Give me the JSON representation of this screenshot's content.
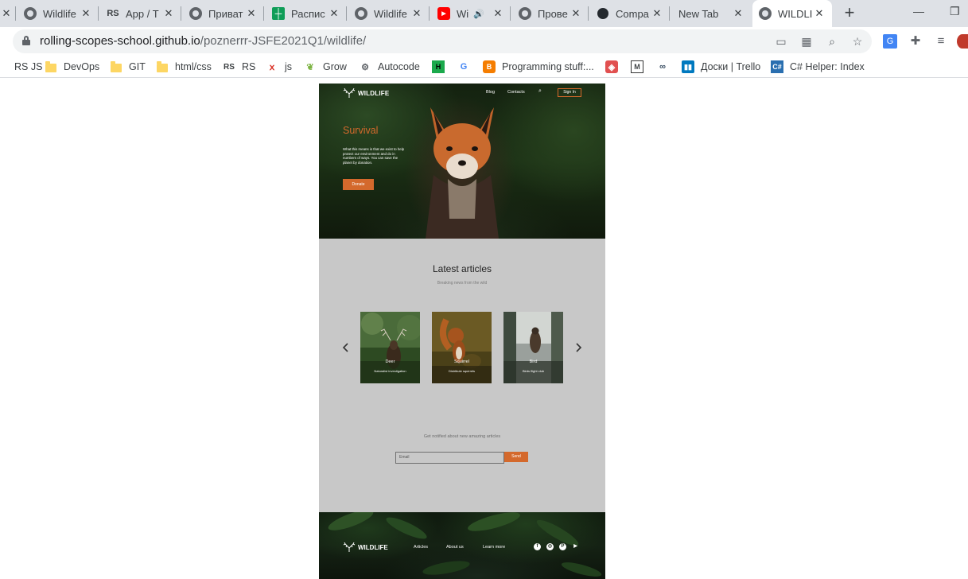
{
  "browser": {
    "tabs": [
      {
        "title": "",
        "icon": "x-close-icon"
      },
      {
        "title": "Wildlife",
        "icon": "globe-icon"
      },
      {
        "title": "App / T",
        "icon": "rs-logo-icon"
      },
      {
        "title": "Приват",
        "icon": "globe-icon"
      },
      {
        "title": "Распис",
        "icon": "sheets-icon"
      },
      {
        "title": "Wildlife",
        "icon": "globe-icon"
      },
      {
        "title": "Wi",
        "icon": "youtube-icon"
      },
      {
        "title": "Прове",
        "icon": "globe-icon"
      },
      {
        "title": "Compa",
        "icon": "github-icon"
      },
      {
        "title": "New Tab",
        "icon": ""
      },
      {
        "title": "WILDLI",
        "icon": "globe-icon"
      }
    ],
    "new_tab_label": "+",
    "url_host": "rolling-scopes-school.github.io",
    "url_path": "/poznerrr-JSFE2021Q1/wildlife/",
    "bookmarks": [
      {
        "label": "RS JS",
        "icon": "page-icon"
      },
      {
        "label": "DevOps",
        "icon": "folder-icon"
      },
      {
        "label": "GIT",
        "icon": "folder-icon"
      },
      {
        "label": "html/css",
        "icon": "folder-icon"
      },
      {
        "label": "RS",
        "icon": "rs-logo-icon"
      },
      {
        "label": "js",
        "icon": "js-icon"
      },
      {
        "label": "Grow",
        "icon": "leaf-icon"
      },
      {
        "label": "Autocode",
        "icon": "autocode-icon"
      },
      {
        "label": "",
        "icon": "hackerrank-icon"
      },
      {
        "label": "",
        "icon": "google-icon"
      },
      {
        "label": "Programming stuff:...",
        "icon": "blogger-icon"
      },
      {
        "label": "",
        "icon": "codepen-icon"
      },
      {
        "label": "",
        "icon": "gmail-icon"
      },
      {
        "label": "",
        "icon": "binoculars-icon"
      },
      {
        "label": "Доски | Trello",
        "icon": "trello-icon"
      },
      {
        "label": "C# Helper: Index",
        "icon": "csharp-icon"
      }
    ]
  },
  "site": {
    "logo": "WILDLIFE",
    "nav": {
      "blog": "Blog",
      "contacts": "Contacts",
      "signin": "Sign In"
    },
    "hero": {
      "title": "Survival",
      "text": "What this means is that we exist to help protect our environment and do in numbers of ways. You can save the planet by donation.",
      "donate": "Donate"
    },
    "articles": {
      "title": "Latest articles",
      "subtitle": "Breaking news from the wild",
      "cards": [
        {
          "name": "Deer",
          "desc": "Naturalist investigation"
        },
        {
          "name": "Squirrel",
          "desc": "Distribute squirrels"
        },
        {
          "name": "Bird",
          "desc": "Birds flight club"
        }
      ]
    },
    "subscribe": {
      "text": "Get notified about new amazing articles",
      "placeholder": "Email",
      "button": "Send"
    },
    "footer": {
      "links": [
        "Articles",
        "About us",
        "Learn more"
      ],
      "social": [
        "facebook-icon",
        "instagram-icon",
        "pinterest-icon",
        "youtube-icon"
      ]
    }
  },
  "colors": {
    "accent": "#d4692c",
    "articles_bg": "#c8c8c8"
  }
}
